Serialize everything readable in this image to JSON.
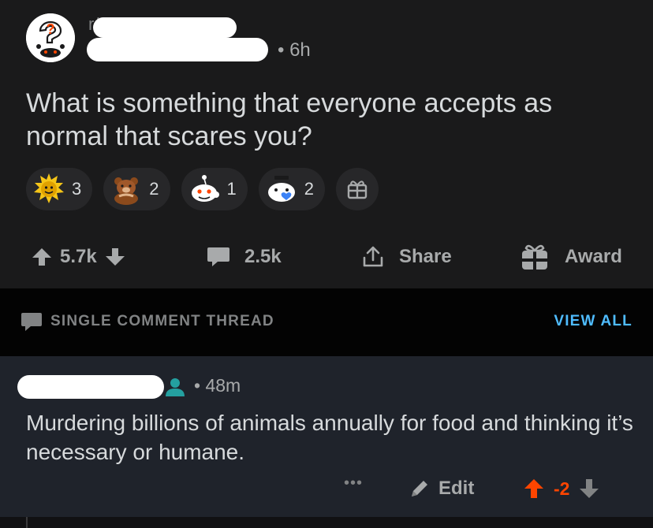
{
  "post": {
    "subreddit_prefix": "r/",
    "time": "• 6h",
    "title": "What is something that everyone accepts as normal that scares you?",
    "awards": [
      {
        "icon": "gold-award-icon",
        "count": "3"
      },
      {
        "icon": "bear-award-icon",
        "count": "2"
      },
      {
        "icon": "snoo-award-icon",
        "count": "1"
      },
      {
        "icon": "wholesome-award-icon",
        "count": "2"
      }
    ],
    "actions": {
      "upvotes": "5.7k",
      "comments": "2.5k",
      "share": "Share",
      "award": "Award"
    }
  },
  "thread": {
    "label": "SINGLE COMMENT THREAD",
    "view_all": "VIEW ALL"
  },
  "comment": {
    "time": "• 48m",
    "body": "Murdering billions of animals annually for food and thinking it’s necessary or humane.",
    "more": "•••",
    "edit": "Edit",
    "score": "-2"
  },
  "colors": {
    "accent_blue": "#4fbcff",
    "upvote_orange": "#ff4500",
    "op_teal": "#24a0a0"
  }
}
